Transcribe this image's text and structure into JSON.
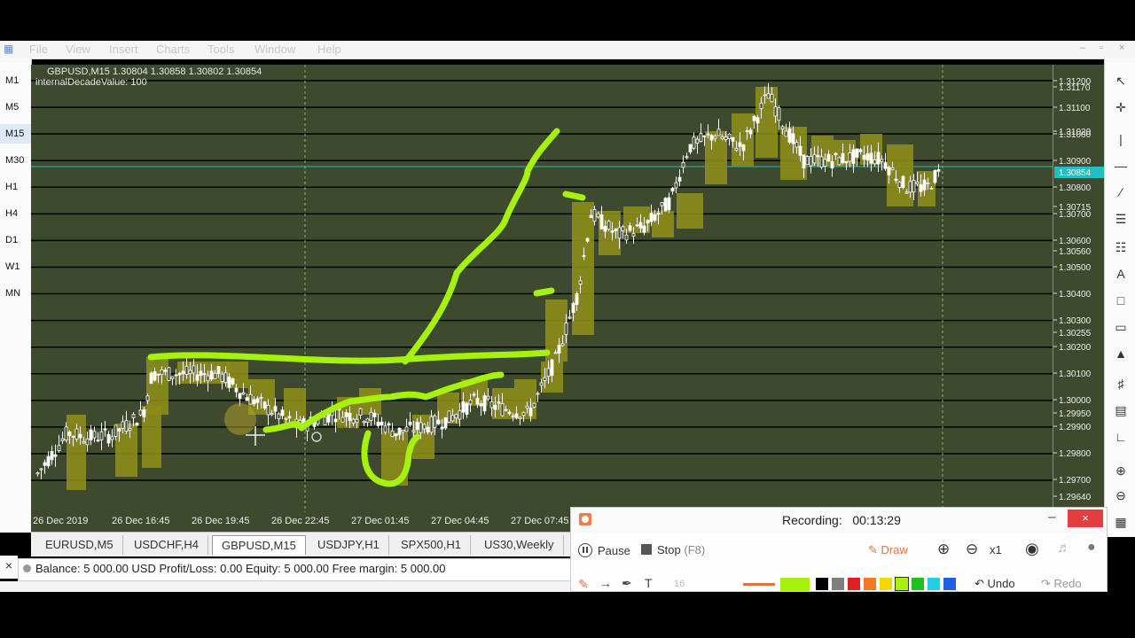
{
  "window": {
    "menu": [
      "File",
      "View",
      "Insert",
      "Charts",
      "Tools",
      "Window",
      "Help"
    ],
    "controls": [
      "–",
      "▫",
      "×"
    ]
  },
  "timeframes": [
    "M1",
    "M5",
    "M15",
    "M30",
    "H1",
    "H4",
    "D1",
    "W1",
    "MN"
  ],
  "active_timeframe": "M15",
  "chart": {
    "symbol_info": "GBPUSD,M15  1.30804 1.30858 1.30802 1.30854",
    "indicator": "internalDecadeValue: 100",
    "current_price": "1.30854",
    "price_labels": [
      "1.31200",
      "1.31170",
      "1.31100",
      "1.31020",
      "1.31000",
      "1.30900",
      "1.30800",
      "1.30715",
      "1.30700",
      "1.30600",
      "1.30560",
      "1.30500",
      "1.30400",
      "1.30300",
      "1.30255",
      "1.30200",
      "1.30100",
      "1.30000",
      "1.29950",
      "1.29900",
      "1.29800",
      "1.29700",
      "1.29640"
    ],
    "time_labels": [
      "26 Dec 2019",
      "26 Dec 16:45",
      "26 Dec 19:45",
      "26 Dec 22:45",
      "27 Dec 01:45",
      "27 Dec 04:45",
      "27 Dec 07:45"
    ],
    "colors": {
      "background": "#3d4a2e",
      "candle": "#ffffff",
      "box": "#8c8c1a",
      "annotation": "#a6f20d",
      "price_line": "#20c0c0"
    }
  },
  "tabs": [
    "EURUSD,M5",
    "USDCHF,H4",
    "GBPUSD,M15",
    "USDJPY,H1",
    "SPX500,H1",
    "US30,Weekly"
  ],
  "active_tab": "GBPUSD,M15",
  "terminal": {
    "close": "×",
    "balance_text": "Balance: 5 000.00 USD   Profit/Loss: 0.00   Equity: 5 000.00   Free margin: 5 000.00"
  },
  "recorder": {
    "status_label": "Recording:",
    "elapsed": "00:13:29",
    "pause_label": "Pause",
    "stop_label": "Stop",
    "stop_shortcut": "(F8)",
    "draw_label": "Draw",
    "zoom_level": "x1",
    "font_size": "16",
    "undo_label": "Undo",
    "redo_label": "Redo",
    "minimize": "–",
    "close": "×",
    "palette": [
      "#000000",
      "#7f7f7f",
      "#e02020",
      "#f07a20",
      "#f5d800",
      "#a6f20d",
      "#20c020",
      "#20d0e0",
      "#2060e0"
    ]
  }
}
